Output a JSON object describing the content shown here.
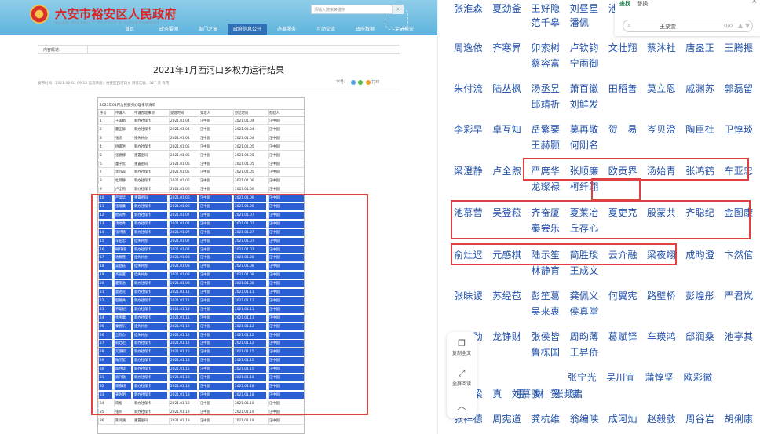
{
  "header": {
    "site_title": "六安市裕安区人民政府",
    "site_subtitle": "YUAN DISTRICT PEOPLE'S GOVERNMENT",
    "search_placeholder": "请输入搜索关键字",
    "nav": [
      "首页",
      "政务要闻",
      "部门之窗",
      "政府信息公开",
      "办事服务",
      "互动交流",
      "政府数据",
      "走进裕安"
    ],
    "active_nav": "政府信息公开"
  },
  "info_label": "内容概述:",
  "document": {
    "title": "2021年1月西河口乡权力运行结果",
    "meta": "发布时间：2021-02-01 09:13  信息来源：裕安区西河口乡  浏览次数：327 次  有用",
    "meta_right": "字号：",
    "meta_share": "打印"
  },
  "table": {
    "caption": "2021年01月为民服务办理事项清单",
    "headers": [
      "序号",
      "申请人",
      "申请办理事项",
      "受理时间",
      "受理人",
      "办结时间",
      "办结人"
    ],
    "rows": [
      [
        "1",
        "王美娟",
        "新办社保卡",
        "2021.01.04",
        "汪中国",
        "2021.01.04",
        "汪中国"
      ],
      [
        "2",
        "夏正群",
        "新办社保卡",
        "2021.01.04",
        "汪中国",
        "2021.01.04",
        "汪中国"
      ],
      [
        "3",
        "张迅",
        "技失补办",
        "2021.01.04",
        "汪中国",
        "2021.01.04",
        "汪中国"
      ],
      [
        "4",
        "杨俊洪",
        "新办社保卡",
        "2021.01.05",
        "汪中国",
        "2021.01.05",
        "汪中国"
      ],
      [
        "5",
        "张德娜",
        "重置密码",
        "2021.01.05",
        "汪中国",
        "2021.01.05",
        "汪中国"
      ],
      [
        "6",
        "童子优",
        "重置密码",
        "2021.01.05",
        "汪中国",
        "2021.01.05",
        "汪中国"
      ],
      [
        "7",
        "李苏霞",
        "新办社保卡",
        "2021.01.05",
        "汪中国",
        "2021.01.05",
        "汪中国"
      ],
      [
        "8",
        "杜源静",
        "新办社保卡",
        "2021.01.06",
        "汪中国",
        "2021.01.06",
        "汪中国"
      ],
      [
        "9",
        "卢全煦",
        "新办社保卡",
        "2021.01.06",
        "汪中国",
        "2021.01.06",
        "汪中国"
      ],
      [
        "10",
        "严席华",
        "重置密码",
        "2021.01.06",
        "汪中国",
        "2021.01.06",
        "汪中国"
      ],
      [
        "11",
        "张顺廉",
        "新办社保卡",
        "2021.01.06",
        "汪中国",
        "2021.01.06",
        "汪中国"
      ],
      [
        "12",
        "欧贡界",
        "新办社保卡",
        "2021.01.07",
        "汪中国",
        "2021.01.07",
        "汪中国"
      ],
      [
        "13",
        "汤始青",
        "新办社保卡",
        "2021.01.07",
        "汪中国",
        "2021.01.07",
        "汪中国"
      ],
      [
        "14",
        "张鸿鹤",
        "新办社保卡",
        "2021.01.07",
        "汪中国",
        "2021.01.07",
        "汪中国"
      ],
      [
        "15",
        "车亚忠",
        "挂失补办",
        "2021.01.07",
        "汪中国",
        "2021.01.07",
        "汪中国"
      ],
      [
        "16",
        "柯纤翊",
        "新办社保卡",
        "2021.01.07",
        "汪中国",
        "2021.01.07",
        "汪中国"
      ],
      [
        "17",
        "池慕营",
        "挂失补办",
        "2021.01.08",
        "汪中国",
        "2021.01.08",
        "汪中国"
      ],
      [
        "18",
        "吴登菘",
        "挂失补办",
        "2021.01.08",
        "汪中国",
        "2021.01.08",
        "汪中国"
      ],
      [
        "19",
        "齐奋厦",
        "挂失补办",
        "2021.01.08",
        "汪中国",
        "2021.01.08",
        "汪中国"
      ],
      [
        "20",
        "夏莱冶",
        "新办社保卡",
        "2021.01.08",
        "汪中国",
        "2021.01.08",
        "汪中国"
      ],
      [
        "21",
        "夏吏克",
        "新办社保卡",
        "2021.01.11",
        "汪中国",
        "2021.01.11",
        "汪中国"
      ],
      [
        "22",
        "殷蒙共",
        "新办社保卡",
        "2021.01.11",
        "汪中国",
        "2021.01.11",
        "汪中国"
      ],
      [
        "23",
        "齐聪纪",
        "新办社保卡",
        "2021.01.11",
        "汪中国",
        "2021.01.11",
        "汪中国"
      ],
      [
        "24",
        "金图康",
        "新办社保卡",
        "2021.01.11",
        "汪中国",
        "2021.01.11",
        "汪中国"
      ],
      [
        "25",
        "秦尝乐",
        "挂失补办",
        "2021.01.12",
        "汪中国",
        "2021.01.12",
        "汪中国"
      ],
      [
        "26",
        "丘存心",
        "挂失补办",
        "2021.01.12",
        "汪中国",
        "2021.01.12",
        "汪中国"
      ],
      [
        "27",
        "俞灶迟",
        "新办社保卡",
        "2021.01.12",
        "汪中国",
        "2021.01.12",
        "汪中国"
      ],
      [
        "28",
        "元感棋",
        "新办社保卡",
        "2021.01.15",
        "汪中国",
        "2021.01.15",
        "汪中国"
      ],
      [
        "29",
        "陆示笙",
        "新办社保卡",
        "2021.01.15",
        "汪中国",
        "2021.01.15",
        "汪中国"
      ],
      [
        "30",
        "简胜琰",
        "新办社保卡",
        "2021.01.15",
        "汪中国",
        "2021.01.15",
        "汪中国"
      ],
      [
        "31",
        "云介融",
        "新办社保卡",
        "2021.01.18",
        "汪中国",
        "2021.01.18",
        "汪中国"
      ],
      [
        "32",
        "梁夜翊",
        "新办社保卡",
        "2021.01.18",
        "汪中国",
        "2021.01.18",
        "汪中国"
      ],
      [
        "33",
        "姜佐明",
        "新办社保卡",
        "2021.01.18",
        "汪中国",
        "2021.01.18",
        "汪中国"
      ],
      [
        "34",
        "简松",
        "新办社保卡",
        "2021.01.18",
        "汪中国",
        "2021.01.18",
        "汪中国"
      ],
      [
        "35",
        "张伟",
        "新办社保卡",
        "2021.01.19",
        "汪中国",
        "2021.01.19",
        "汪中国"
      ],
      [
        "36",
        "陈诗涵",
        "重置密码",
        "2021.01.19",
        "汪中国",
        "2021.01.19",
        "汪中国"
      ]
    ],
    "selected_from": 9,
    "selected_to": 32
  },
  "names_panel": {
    "rows": [
      "张淮森　夏劲釜　王好隐　刘昼星　池呆",
      "　　　　　　　　范千皋　潘佩",
      "周逸依　齐寒昇　卯索树　卢钦钧　文壮翔　蔡沐社　唐盎正　王腾振",
      "　　　　　　　　蔡容富　宁雨御",
      "朱付流　陆丛枫　汤丞昱　萧百徽　田稻善　莫立恩　戚渊苏　郭磊留",
      "　　　　　　　　邱靖祈　刘鲜发",
      "李彩早　卓互知　岳繁粟　莫再敬　贺　易　岑贝澄　陶臣杜　卫惇琰",
      "　　　　　　　　王赫颢　何刚名",
      "梁澄静　卢全煦　严席华　张顺廉　欧贡界　汤始青　张鸿鹤　车亚忠",
      "　　　　　　　　龙璨禄　柯纤翊",
      "池慕营　吴登菘　齐奋厦　夏莱冶　夏吏克　殷蒙共　齐聪纪　金图康",
      "　　　　　　　　秦尝乐　丘存心",
      "俞灶迟　元感棋　陆示笙　简胜琰　云介融　梁夜翊　成昀澄　卞然倌",
      "　　　　　　　　林静育　王成文",
      "张昧谡　苏经苞　彭笙葛　龚佩义　何翼宪　路壁桥　彭煌彤　严君岚",
      "　　　　　　　　吴来衷　侯真堂",
      "　　劲　龙铮财　张侯皆　周昀薄　葛赋铎　车瑛鸿　邸润桑　池亭其",
      "　　　　　　　　鲁栋国　王昇侨",
      "　　　　　　　　　　张宁光　吴川宜　蒲惇坚　欧彩徽",
      "　　梁　真　刘慕骏　贺　演",
      "　　　　　　　　雷　琳　张频启",
      "张祥德　周宪道　龚杭维　翁编映　成河灿　赵毅敦　周谷岩　胡俐康"
    ]
  },
  "find_bar": {
    "tab_find": "查找",
    "tab_replace": "替换",
    "term": "王栗萱",
    "count": "0/0"
  },
  "side_tools": {
    "copy_all": "复制全文",
    "fullscreen": "全屏阅读"
  },
  "colors": {
    "highlight": "#2a5fd4",
    "redbox": "#e04040",
    "name_blue": "#2050a8",
    "header": "#5eb3dd"
  }
}
